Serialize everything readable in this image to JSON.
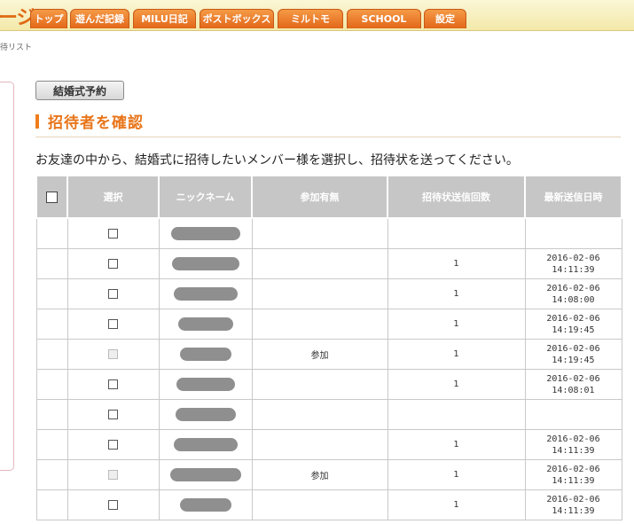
{
  "header": {
    "brand_fragment": "ージ",
    "nav": [
      {
        "label": "トップ"
      },
      {
        "label": "遊んだ記録"
      },
      {
        "label": "MILU日記"
      },
      {
        "label": "ポストボックス"
      },
      {
        "label": "ミルトモ"
      },
      {
        "label": "SCHOOL"
      },
      {
        "label": "設定"
      }
    ]
  },
  "breadcrumb": "待リスト",
  "tag_button": "結婚式予約",
  "section_title": "招待者を確認",
  "intro": "お友達の中から、結婚式に招待したいメンバー様を選択し、招待状を送ってください。",
  "table": {
    "headers": {
      "select": "選択",
      "nickname": "ニックネーム",
      "attendance": "参加有無",
      "send_count": "招待状送信回数",
      "last_sent": "最新送信日時"
    },
    "rows": [
      {
        "disabled": false,
        "attendance": "",
        "count": "",
        "date": "",
        "time": ""
      },
      {
        "disabled": false,
        "attendance": "",
        "count": "1",
        "date": "2016-02-06",
        "time": "14:11:39"
      },
      {
        "disabled": false,
        "attendance": "",
        "count": "1",
        "date": "2016-02-06",
        "time": "14:08:00"
      },
      {
        "disabled": false,
        "attendance": "",
        "count": "1",
        "date": "2016-02-06",
        "time": "14:19:45"
      },
      {
        "disabled": true,
        "attendance": "参加",
        "count": "1",
        "date": "2016-02-06",
        "time": "14:19:45"
      },
      {
        "disabled": false,
        "attendance": "",
        "count": "1",
        "date": "2016-02-06",
        "time": "14:08:01"
      },
      {
        "disabled": false,
        "attendance": "",
        "count": "",
        "date": "",
        "time": ""
      },
      {
        "disabled": false,
        "attendance": "",
        "count": "1",
        "date": "2016-02-06",
        "time": "14:11:39"
      },
      {
        "disabled": true,
        "attendance": "参加",
        "count": "1",
        "date": "2016-02-06",
        "time": "14:11:39"
      },
      {
        "disabled": false,
        "attendance": "",
        "count": "1",
        "date": "2016-02-06",
        "time": "14:11:39"
      }
    ]
  },
  "colors": {
    "accent": "#e8751a",
    "tab": "#e97a24",
    "header_bg": "#c6c6c6"
  }
}
